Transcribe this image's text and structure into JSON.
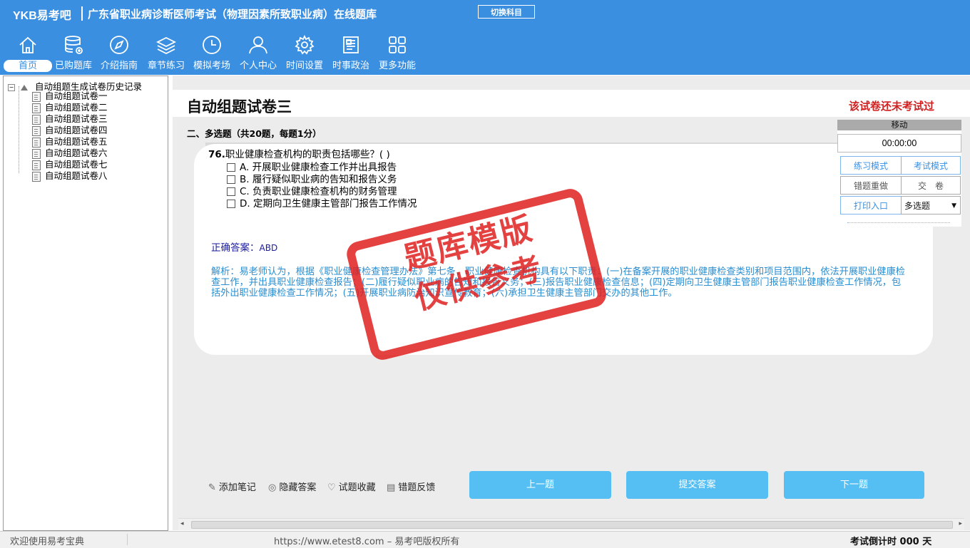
{
  "app": {
    "logo": "YKB易考吧",
    "title": "广东省职业病诊断医师考试（物理因素所致职业病）在线题库",
    "switch_subject": "切换科目"
  },
  "nav": {
    "items": [
      {
        "label": "首页",
        "icon": "home-icon"
      },
      {
        "label": "已购题库",
        "icon": "database-icon"
      },
      {
        "label": "介绍指南",
        "icon": "compass-icon"
      },
      {
        "label": "章节练习",
        "icon": "layers-icon"
      },
      {
        "label": "模拟考场",
        "icon": "clock-icon"
      },
      {
        "label": "个人中心",
        "icon": "user-icon"
      },
      {
        "label": "时间设置",
        "icon": "gear-icon"
      },
      {
        "label": "时事政治",
        "icon": "news-icon"
      },
      {
        "label": "更多功能",
        "icon": "grid-icon"
      }
    ]
  },
  "sidebar": {
    "root": "自动组题生成试卷历史记录",
    "items": [
      "自动组题试卷一",
      "自动组题试卷二",
      "自动组题试卷三",
      "自动组题试卷四",
      "自动组题试卷五",
      "自动组题试卷六",
      "自动组题试卷七",
      "自动组题试卷八"
    ]
  },
  "paper": {
    "title": "自动组题试卷三",
    "status": "该试卷还未考试过",
    "section": "二、多选题（共20题，每题1分）"
  },
  "question": {
    "number": "76.",
    "text": "职业健康检查机构的职责包括哪些？( )",
    "options": [
      "A. 开展职业健康检查工作并出具报告",
      "B. 履行疑似职业病的告知和报告义务",
      "C. 负责职业健康检查机构的财务管理",
      "D. 定期向卫生健康主管部门报告工作情况"
    ],
    "answer_label": "正确答案：",
    "answer_value": "ABD",
    "analysis": "解析：易老师认为，根据《职业健康检查管理办法》第七条，职业健康检查机构具有以下职责：(一)在备案开展的职业健康检查类别和项目范围内，依法开展职业健康检查工作，并出具职业健康检查报告；(二)履行疑似职业病的告知和报告义务；(三)报告职业健康检查信息；(四)定期向卫生健康主管部门报告职业健康检查工作情况，包括外出职业健康检查工作情况；(五)开展职业病防治知识宣传教育；(六)承担卫生健康主管部门交办的其他工作。"
  },
  "tools": {
    "note": "添加笔记",
    "hide_answer": "隐藏答案",
    "favorite": "试题收藏",
    "feedback": "错题反馈"
  },
  "buttons": {
    "prev": "上一题",
    "submit": "提交答案",
    "next": "下一题"
  },
  "panel": {
    "move": "移动",
    "timer": "00:00:00",
    "practice_mode": "练习模式",
    "exam_mode": "考试模式",
    "redo_wrong": "错题重做",
    "submit_paper": "交　卷",
    "print": "打印入口",
    "type_select": "多选题"
  },
  "stamp": {
    "line1": "题库模版",
    "line2": "仅供参考"
  },
  "statusbar": {
    "welcome": "欢迎使用易考宝典",
    "copyright": "https://www.etest8.com – 易考吧版权所有",
    "countdown": "考试倒计时 000 天"
  }
}
